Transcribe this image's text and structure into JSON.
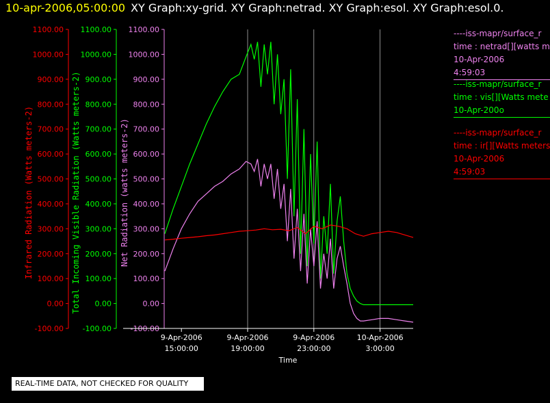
{
  "header": {
    "timestamp": "10-apr-2006,05:00:00",
    "titles": "XY Graph:xy-grid.  XY Graph:netrad.  XY Graph:esol.  XY Graph:esol.0."
  },
  "footer": "REAL-TIME DATA, NOT CHECKED FOR QUALITY",
  "colors": {
    "ir": "#ff0000",
    "vis": "#00ff00",
    "net": "#ee82ee",
    "grid": "#ffffff",
    "axis": "#ffffff"
  },
  "legend": [
    {
      "color": "#ee82ee",
      "lines": [
        "----iss-mapr/surface_r",
        "time : netrad[][watts m",
        "10-Apr-2006",
        "4:59:03"
      ]
    },
    {
      "color": "#00ff00",
      "lines": [
        "----iss-mapr/surface_r",
        "time : vis[][Watts mete",
        "10-Apr-200o"
      ]
    },
    {
      "color": "#ff0000",
      "lines": [
        "----iss-mapr/surface_r",
        "time : ir[][Watts meters",
        "10-Apr-2006",
        "4:59:03"
      ]
    }
  ],
  "chart_data": {
    "type": "line",
    "xlabel": "Time",
    "x_ticks": [
      {
        "t": 15,
        "label": [
          "9-Apr-2006",
          "15:00:00"
        ]
      },
      {
        "t": 19,
        "label": [
          "9-Apr-2006",
          "19:00:00"
        ]
      },
      {
        "t": 23,
        "label": [
          "9-Apr-2006",
          "23:00:00"
        ]
      },
      {
        "t": 27,
        "label": [
          "10-Apr-2006",
          "3:00:00"
        ]
      }
    ],
    "vertical_grid_at": [
      19,
      23,
      27
    ],
    "xlim": [
      14.0,
      29.0
    ],
    "ylim": [
      -100,
      1100
    ],
    "y_ticks": [
      "-100.00",
      "0.00",
      "100.00",
      "200.00",
      "300.00",
      "400.00",
      "500.00",
      "600.00",
      "700.00",
      "800.00",
      "900.00",
      "1000.00",
      "1100.00"
    ],
    "axes": [
      {
        "label": "Infrared Radiation (Watts meters-2)",
        "color": "#ff0000"
      },
      {
        "label": "Total Incoming Visible Radiation (Watts meters-2)",
        "color": "#00ff00"
      },
      {
        "label": "Net Radiation (watts meters-2)",
        "color": "#ee82ee"
      }
    ],
    "series": [
      {
        "label": "Total Incoming Visible Radiation",
        "color": "#00ff00",
        "x": [
          14.0,
          14.5,
          15.0,
          15.5,
          16.0,
          16.5,
          17.0,
          17.5,
          18.0,
          18.5,
          18.9,
          19.2,
          19.4,
          19.6,
          19.8,
          20.0,
          20.2,
          20.4,
          20.6,
          20.8,
          21.0,
          21.2,
          21.4,
          21.6,
          21.8,
          22.0,
          22.2,
          22.4,
          22.6,
          22.8,
          23.0,
          23.2,
          23.4,
          23.6,
          23.8,
          24.0,
          24.2,
          24.4,
          24.6,
          24.8,
          25.0,
          25.2,
          25.4,
          25.6,
          25.8,
          26.0,
          26.5,
          27.0,
          27.5,
          28.0,
          28.5,
          29.0
        ],
        "y": [
          280,
          380,
          470,
          560,
          640,
          720,
          790,
          850,
          900,
          920,
          990,
          1040,
          980,
          1050,
          870,
          1040,
          920,
          1050,
          800,
          1000,
          760,
          900,
          500,
          940,
          350,
          820,
          200,
          700,
          150,
          600,
          240,
          650,
          100,
          350,
          200,
          480,
          120,
          330,
          430,
          250,
          120,
          60,
          30,
          10,
          0,
          -5,
          -5,
          -5,
          -5,
          -5,
          -5,
          -5
        ]
      },
      {
        "label": "Net Radiation",
        "color": "#ee82ee",
        "x": [
          14.0,
          14.5,
          15.0,
          15.5,
          16.0,
          16.5,
          17.0,
          17.5,
          18.0,
          18.5,
          18.9,
          19.2,
          19.4,
          19.6,
          19.8,
          20.0,
          20.2,
          20.4,
          20.6,
          20.8,
          21.0,
          21.2,
          21.4,
          21.6,
          21.8,
          22.0,
          22.2,
          22.4,
          22.6,
          22.8,
          23.0,
          23.2,
          23.4,
          23.6,
          23.8,
          24.0,
          24.2,
          24.4,
          24.6,
          24.8,
          25.0,
          25.2,
          25.4,
          25.6,
          25.8,
          26.0,
          26.5,
          27.0,
          27.5,
          28.0,
          28.5,
          29.0
        ],
        "y": [
          130,
          220,
          300,
          360,
          410,
          440,
          470,
          490,
          520,
          540,
          570,
          560,
          530,
          580,
          470,
          560,
          500,
          560,
          420,
          540,
          380,
          480,
          250,
          460,
          180,
          380,
          130,
          360,
          80,
          300,
          150,
          330,
          60,
          200,
          100,
          260,
          60,
          180,
          230,
          150,
          80,
          0,
          -40,
          -60,
          -70,
          -70,
          -65,
          -60,
          -60,
          -65,
          -70,
          -75
        ]
      },
      {
        "label": "Infrared Radiation",
        "color": "#ff0000",
        "x": [
          14.0,
          14.5,
          15.0,
          15.5,
          16.0,
          16.5,
          17.0,
          17.5,
          18.0,
          18.5,
          19.0,
          19.5,
          20.0,
          20.5,
          21.0,
          21.5,
          22.0,
          22.5,
          23.0,
          23.5,
          24.0,
          24.5,
          25.0,
          25.5,
          26.0,
          26.5,
          27.0,
          27.5,
          28.0,
          28.5,
          29.0
        ],
        "y": [
          255,
          258,
          262,
          265,
          268,
          272,
          275,
          280,
          285,
          290,
          292,
          295,
          300,
          296,
          298,
          292,
          305,
          280,
          310,
          300,
          315,
          310,
          300,
          280,
          270,
          280,
          285,
          290,
          285,
          275,
          265
        ]
      }
    ]
  }
}
